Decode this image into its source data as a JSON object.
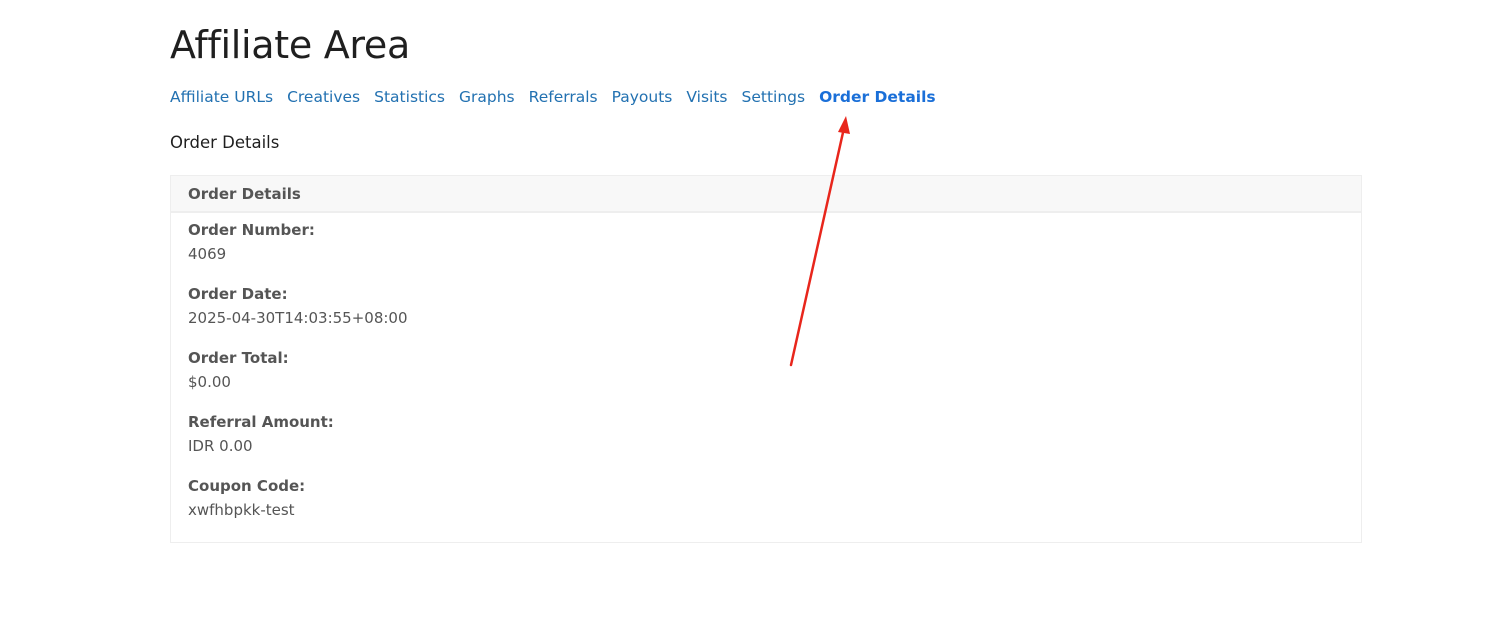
{
  "page": {
    "title": "Affiliate Area",
    "section_heading": "Order Details"
  },
  "tabs": [
    {
      "label": "Affiliate URLs",
      "active": false
    },
    {
      "label": "Creatives",
      "active": false
    },
    {
      "label": "Statistics",
      "active": false
    },
    {
      "label": "Graphs",
      "active": false
    },
    {
      "label": "Referrals",
      "active": false
    },
    {
      "label": "Payouts",
      "active": false
    },
    {
      "label": "Visits",
      "active": false
    },
    {
      "label": "Settings",
      "active": false
    },
    {
      "label": "Order Details",
      "active": true
    }
  ],
  "card": {
    "header": "Order Details",
    "fields": [
      {
        "label": "Order Number:",
        "value": "4069"
      },
      {
        "label": "Order Date:",
        "value": "2025-04-30T14:03:55+08:00"
      },
      {
        "label": "Order Total:",
        "value": "$0.00"
      },
      {
        "label": "Referral Amount:",
        "value": "IDR 0.00"
      },
      {
        "label": "Coupon Code:",
        "value": "xwfhbpkk-test"
      }
    ]
  },
  "colors": {
    "link": "#2271b1",
    "active_link": "#1a6fd8",
    "annotation_arrow": "#e8261c"
  }
}
